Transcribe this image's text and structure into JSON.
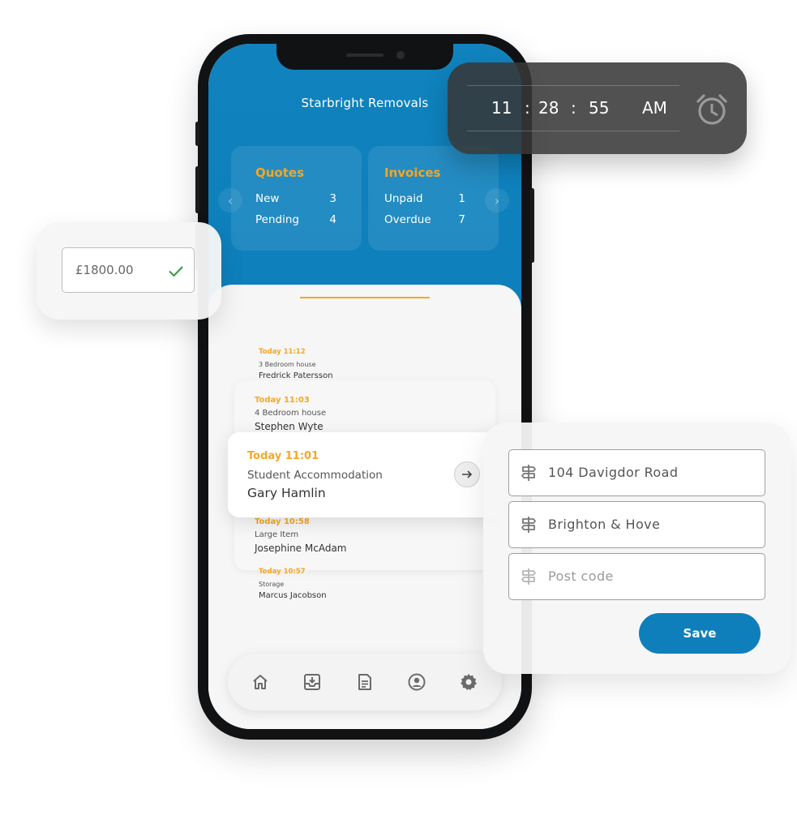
{
  "app": {
    "title": "Starbright Removals"
  },
  "quotes": {
    "heading": "Quotes",
    "rows": [
      {
        "label": "New",
        "count": "3"
      },
      {
        "label": "Pending",
        "count": "4"
      }
    ]
  },
  "invoices": {
    "heading": "Invoices",
    "rows": [
      {
        "label": "Unpaid",
        "count": "1"
      },
      {
        "label": "Overdue",
        "count": "7"
      }
    ]
  },
  "jobs": [
    {
      "time": "Today 11:12",
      "type": "3 Bedroom house",
      "name": "Fredrick Patersson"
    },
    {
      "time": "Today 11:03",
      "type": "4 Bedroom house",
      "name": "Stephen Wyte"
    },
    {
      "time": "Today 11:01",
      "type": "Student Accommodation",
      "name": "Gary Hamlin"
    },
    {
      "time": "Today 10:58",
      "type": "Large Item",
      "name": "Josephine McAdam"
    },
    {
      "time": "Today 10:57",
      "type": "Storage",
      "name": "Marcus Jacobson"
    }
  ],
  "tabbar": {
    "icons": [
      "home-icon",
      "inbox-download-icon",
      "document-icon",
      "account-circle-icon",
      "settings-gear-icon"
    ]
  },
  "price_field": {
    "value": "£1800.00",
    "valid": true
  },
  "clock": {
    "hour": "11",
    "minute": "28",
    "second": "55",
    "period": "AM",
    "sep": ":"
  },
  "address_form": {
    "street": "104 Davigdor Road",
    "city": "Brighton & Hove",
    "postcode_placeholder": "Post code",
    "save_label": "Save"
  },
  "colors": {
    "brand_blue": "#0e7fbb",
    "accent_orange": "#f5a623",
    "check_green": "#2e9b3a"
  }
}
